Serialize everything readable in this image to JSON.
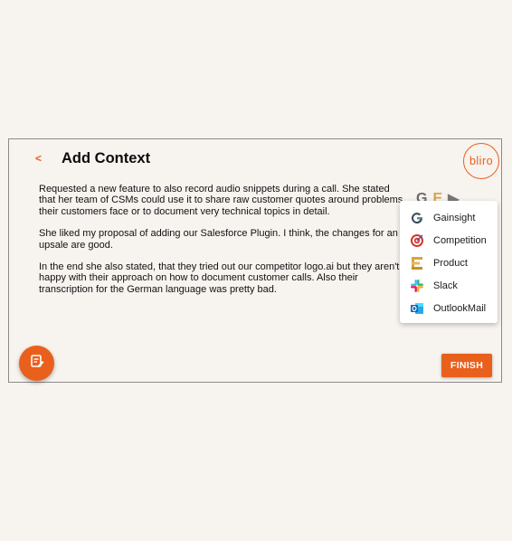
{
  "header": {
    "back_label": "<",
    "title": "Add Context",
    "logo_text": "bliro"
  },
  "content": {
    "paragraphs": [
      "Requested a new feature to also record audio snippets during a call. She stated that her team of CSMs could use it to share raw customer quotes around problems their customers face or to document very technical topics in detail.",
      "She liked my proposal of adding our Salesforce Plugin. I think, the changes for an upsale are good.",
      "In the end she also stated, that they tried out our competitor logo.ai but they aren't happy with their approach on how to document customer calls. Also their transcription for the German language was pretty bad."
    ]
  },
  "integration_menu": {
    "items": [
      {
        "label": "Gainsight",
        "icon": "gainsight-icon"
      },
      {
        "label": "Competition",
        "icon": "target-icon"
      },
      {
        "label": "Product",
        "icon": "product-icon"
      },
      {
        "label": "Slack",
        "icon": "slack-icon"
      },
      {
        "label": "OutlookMail",
        "icon": "outlook-icon"
      }
    ]
  },
  "actions": {
    "finish_label": "FINISH"
  },
  "colors": {
    "accent": "#e8601c",
    "background": "#f7f3ef"
  }
}
